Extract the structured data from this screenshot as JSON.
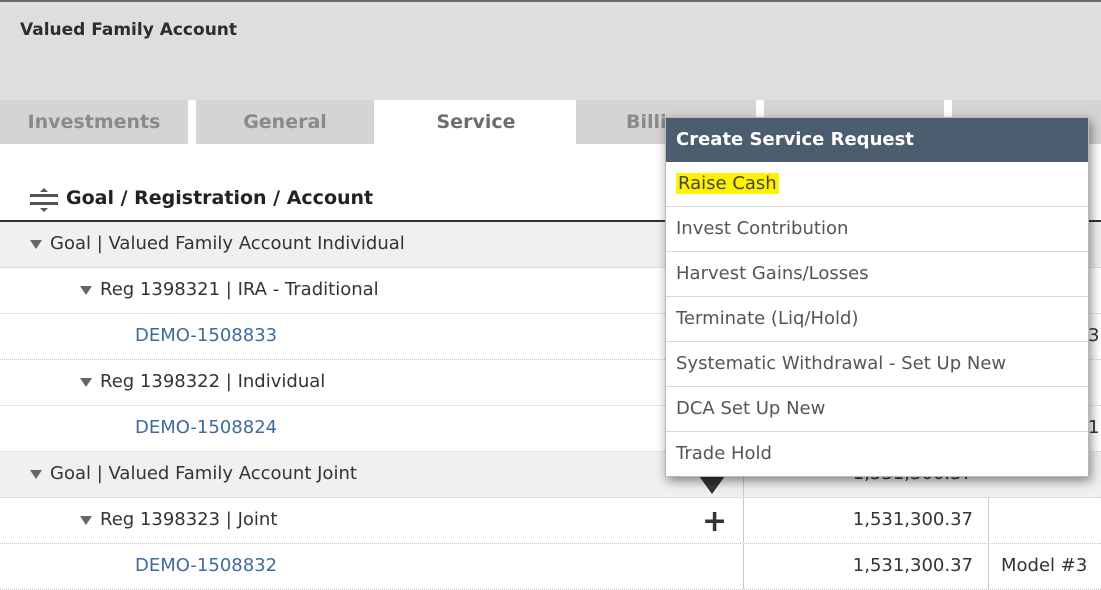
{
  "account": {
    "title": "Valued Family Account"
  },
  "tabs": [
    {
      "label": "Investments"
    },
    {
      "label": "General"
    },
    {
      "label": "Service"
    },
    {
      "label": "Billi"
    }
  ],
  "table": {
    "column_header": "Goal / Registration / Account",
    "rows": [
      {
        "label": "Goal | Valued Family Account Individual"
      },
      {
        "label": "Reg 1398321 | IRA - Traditional"
      },
      {
        "label": "DEMO-1508833",
        "peek": "3"
      },
      {
        "label": "Reg 1398322 | Individual"
      },
      {
        "label": "DEMO-1508824",
        "peek": "1"
      },
      {
        "label": "Goal | Valued Family Account Joint",
        "value": "1,531,300.37"
      },
      {
        "label": "Reg 1398323 | Joint",
        "value": "1,531,300.37"
      },
      {
        "label": "DEMO-1508832",
        "value": "1,531,300.37",
        "model": "Model #3"
      }
    ]
  },
  "menu": {
    "title": "Create Service Request",
    "items": [
      {
        "label": "Raise Cash",
        "highlighted": true
      },
      {
        "label": "Invest Contribution"
      },
      {
        "label": "Harvest Gains/Losses"
      },
      {
        "label": "Terminate (Liq/Hold)"
      },
      {
        "label": "Systematic Withdrawal - Set Up New"
      },
      {
        "label": "DCA Set Up New"
      },
      {
        "label": "Trade Hold"
      }
    ]
  },
  "icons": [
    "drag-handle-icon",
    "expand-triangle-icon",
    "add-icon",
    "menu-pointer-icon"
  ],
  "colors": {
    "menu_header": "#4b5d6f",
    "highlight": "#fff200",
    "link": "#3e6b9e"
  }
}
